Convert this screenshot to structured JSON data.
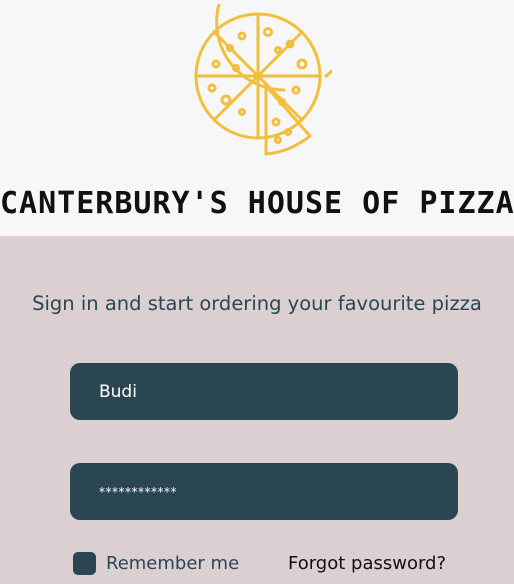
{
  "brand": {
    "name": "CANTERBURY'S HOUSE OF PIZZA",
    "logo_icon": "pizza-icon",
    "logo_color": "#f0bf3e"
  },
  "login": {
    "tagline": "Sign in and start ordering your favourite pizza",
    "username_value": "Budi",
    "password_value": "************",
    "remember_label": "Remember me",
    "forgot_label": "Forgot password?"
  },
  "colors": {
    "header_bg": "#f7f7f7",
    "panel_bg": "#dbcfd1",
    "field_bg": "#2a4653",
    "text_dark": "#2b4653"
  }
}
